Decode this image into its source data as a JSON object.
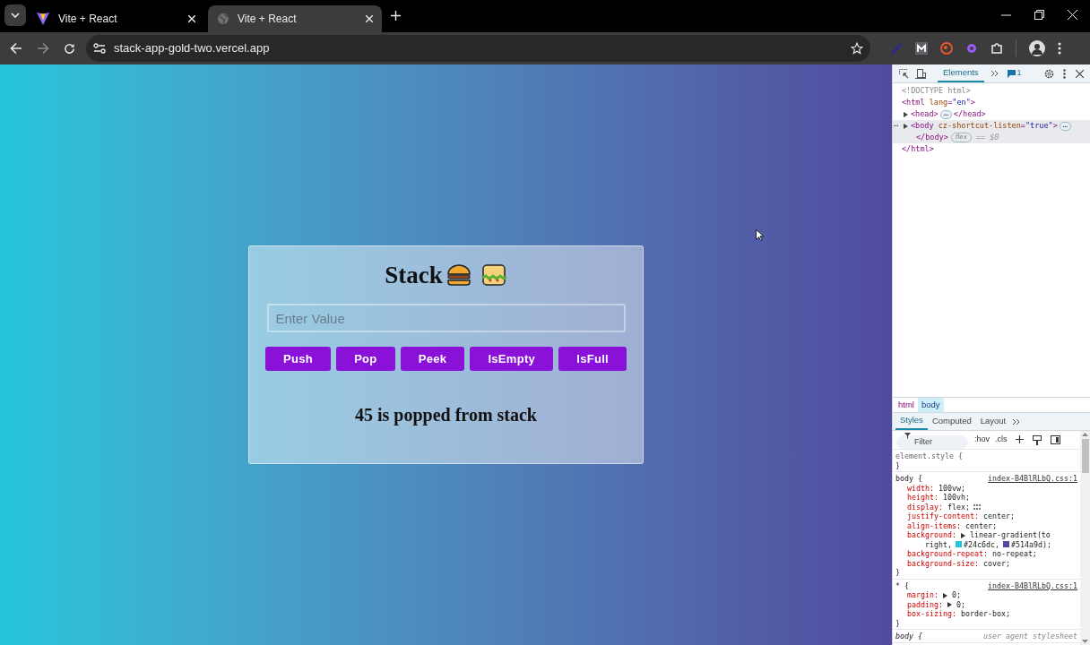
{
  "browser": {
    "tabs": [
      {
        "title": "Vite + React",
        "selected": false,
        "kind": "vite"
      },
      {
        "title": "Vite + React",
        "selected": true,
        "kind": "globe"
      }
    ],
    "url": "stack-app-gold-two.vercel.app"
  },
  "page": {
    "title": "Stack",
    "input": {
      "placeholder": "Enter Value"
    },
    "buttons": [
      "Push",
      "Pop",
      "Peek",
      "IsEmpty",
      "IsFull"
    ],
    "message": "45 is popped from stack"
  },
  "devtools": {
    "panel_tabs": [
      {
        "label": "Elements",
        "selected": true
      }
    ],
    "issues_count": "1",
    "dom": [
      {
        "tokens": [
          {
            "kind": "comment",
            "text": "<!DOCTYPE html>"
          }
        ]
      },
      {
        "tokens": [
          {
            "kind": "tag",
            "text": "<html "
          },
          {
            "kind": "attr",
            "text": "lang"
          },
          {
            "kind": "tag",
            "text": "="
          },
          {
            "kind": "value",
            "text": "\"en\""
          },
          {
            "kind": "tag",
            "text": ">"
          }
        ],
        "closing": [
          {
            "kind": "tag",
            "text": "</html>"
          }
        ],
        "children": [
          {
            "tokens": [
              {
                "kind": "tag",
                "text": "<head>"
              },
              {
                "kind": "pill",
                "text": "⋯"
              },
              {
                "kind": "tag",
                "text": "</head>"
              }
            ],
            "expandable": true,
            "selected": false
          },
          {
            "marker": "⋯",
            "tokens": [
              {
                "kind": "tag",
                "text": "<body "
              },
              {
                "kind": "attr",
                "text": "cz-shortcut-listen"
              },
              {
                "kind": "tag",
                "text": "="
              },
              {
                "kind": "value",
                "text": "\"true\""
              },
              {
                "kind": "tag",
                "text": ">"
              },
              {
                "kind": "pill",
                "text": "⋯"
              }
            ],
            "continuation": [
              {
                "kind": "tag",
                "text": "</body>"
              },
              {
                "kind": "badge",
                "text": "flex"
              },
              {
                "kind": "dim",
                "text": "== $0"
              }
            ],
            "expandable": true,
            "selected": true
          }
        ]
      }
    ],
    "breadcrumbs": [
      {
        "label": "html",
        "selected": false
      },
      {
        "label": "body",
        "selected": true
      }
    ],
    "style_tabs": [
      {
        "label": "Styles",
        "selected": true
      },
      {
        "label": "Computed",
        "selected": false
      },
      {
        "label": "Layout",
        "selected": false
      }
    ],
    "filter": {
      "placeholder": "Filter"
    },
    "filter_buttons": [
      ":hov",
      ".cls"
    ],
    "rules": [
      {
        "kind": "inline",
        "selector": "element.style {",
        "close": "}"
      },
      {
        "kind": "author",
        "selector": "body {",
        "source": "index-B4BlRLbQ.css:1",
        "close": "}",
        "declarations": [
          {
            "prop": "width:",
            "value": [
              {
                "kind": "text",
                "text": "100vw;"
              }
            ]
          },
          {
            "prop": "height:",
            "value": [
              {
                "kind": "text",
                "text": "100vh;"
              }
            ]
          },
          {
            "prop": "display:",
            "value": [
              {
                "kind": "text",
                "text": "flex;"
              },
              {
                "kind": "editor"
              }
            ]
          },
          {
            "prop": "justify-content:",
            "value": [
              {
                "kind": "text",
                "text": "center;"
              }
            ]
          },
          {
            "prop": "align-items:",
            "value": [
              {
                "kind": "text",
                "text": "center;"
              }
            ]
          },
          {
            "prop": "background:",
            "value": [
              {
                "kind": "toggle"
              },
              {
                "kind": "text",
                "text": "linear-gradient(to"
              },
              {
                "kind": "break"
              },
              {
                "kind": "text",
                "text": "right,"
              },
              {
                "kind": "swatch",
                "color": "#24c6dc",
                "text": "#24c6dc,"
              },
              {
                "kind": "swatch",
                "color": "#514a9d",
                "text": "#514a9d);"
              }
            ]
          },
          {
            "prop": "background-repeat:",
            "value": [
              {
                "kind": "text",
                "text": "no-repeat;"
              }
            ]
          },
          {
            "prop": "background-size:",
            "value": [
              {
                "kind": "text",
                "text": "cover;"
              }
            ]
          }
        ]
      },
      {
        "kind": "author",
        "selector": "* {",
        "source": "index-B4BlRLbQ.css:1",
        "close": "}",
        "declarations": [
          {
            "prop": "margin:",
            "value": [
              {
                "kind": "toggle"
              },
              {
                "kind": "text",
                "text": "0;"
              }
            ]
          },
          {
            "prop": "padding:",
            "value": [
              {
                "kind": "toggle"
              },
              {
                "kind": "text",
                "text": "0;"
              }
            ]
          },
          {
            "prop": "box-sizing:",
            "value": [
              {
                "kind": "text",
                "text": "border-box;"
              }
            ]
          }
        ]
      },
      {
        "kind": "agent",
        "selector": "body {",
        "source": "user agent stylesheet"
      }
    ]
  }
}
